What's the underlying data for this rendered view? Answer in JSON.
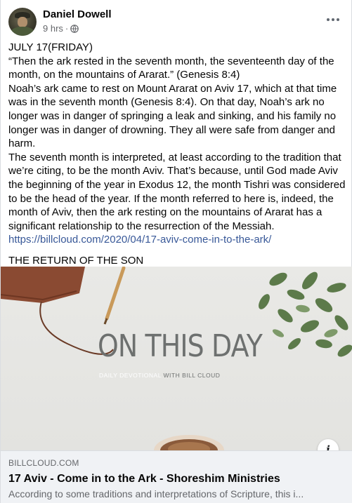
{
  "post": {
    "author": "Daniel Dowell",
    "time": "9 hrs",
    "separator": "·",
    "privacy_icon": "globe-icon",
    "lines": {
      "date": "JULY 17(FRIDAY)",
      "quote": "“Then the ark rested in the seventh month, the seventeenth day of the month, on the mountains of Ararat.” (Genesis 8:4)",
      "para1": "Noah’s ark came to rest on Mount Ararat on Aviv 17, which at that time was in the seventh month (Genesis 8:4). On that day, Noah’s ark no longer was in danger of springing a leak and sinking, and his family no longer was in danger of drowning. They all were safe from danger and harm.",
      "para2": "The seventh month is interpreted, at least according to the tradition that we’re citing, to be the month Aviv. That’s because, until God made Aviv the beginning of the year in Exodus 12, the month Tishri was considered to be the head of the year. If the month referred to here is, indeed, the month of Aviv, then the ark resting on the mountains of Ararat has a significant relationship to the resurrection of the Messiah.",
      "link": "https://billcloud.com/2020/04/17-aviv-come-in-to-the-ark/",
      "closing": "THE RETURN OF THE SON"
    }
  },
  "preview": {
    "image_title": "ON THIS DAY",
    "image_subtitle_a": "DAILY DEVOTIONAL",
    "image_subtitle_b": "WITH BILL CLOUD",
    "info_label": "i",
    "domain": "BILLCLOUD.COM",
    "title": "17 Aviv - Come in to the Ark - Shoreshim Ministries",
    "description": "According to some traditions and interpretations of Scripture, this i..."
  },
  "colors": {
    "link": "#385898",
    "muted": "#65676b",
    "footer_bg": "#f0f2f5"
  }
}
